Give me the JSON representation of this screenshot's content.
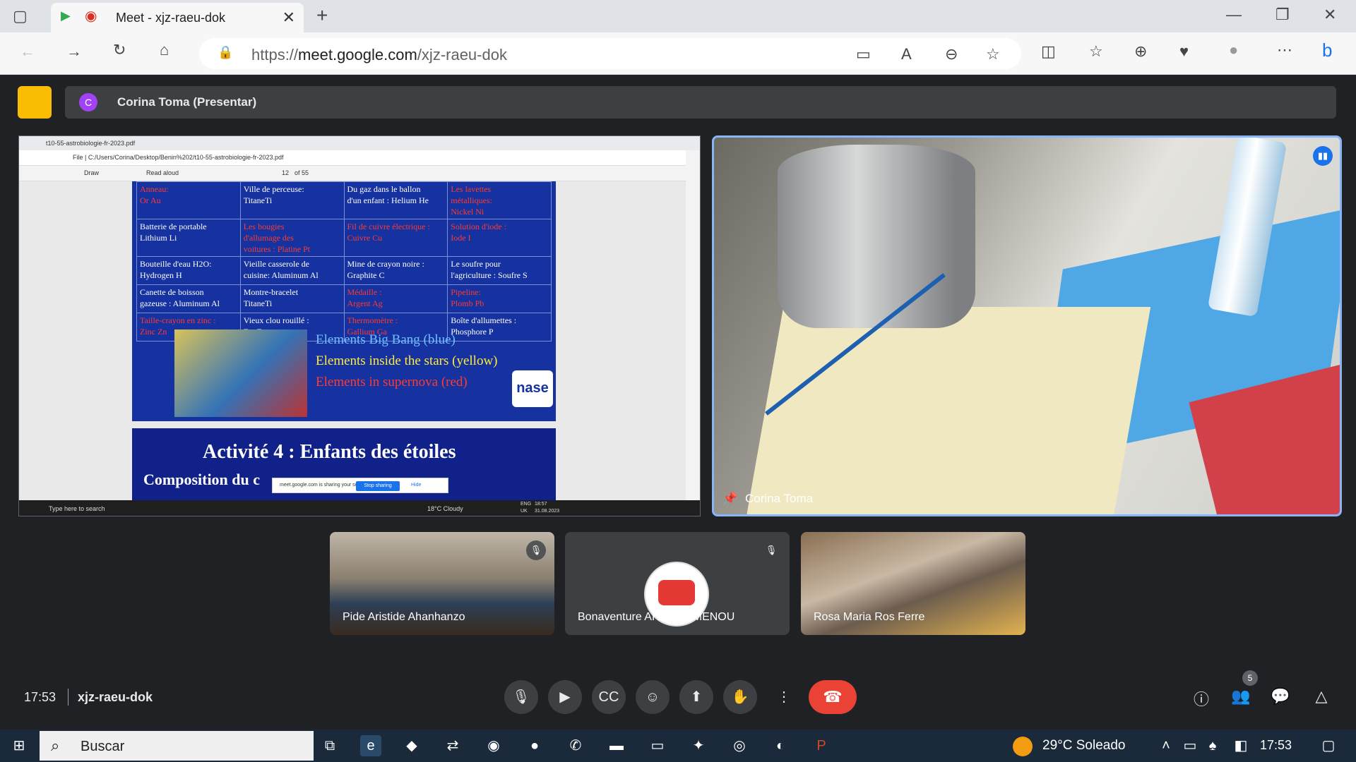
{
  "browser": {
    "tab_title": "Meet - xjz-raeu-dok",
    "url_prefix": "https://",
    "url_host": "meet.google.com",
    "url_path": "/xjz-raeu-dok"
  },
  "meet": {
    "presenter_initial": "C",
    "presenter_banner": "Corina Toma (Presentar)",
    "main_video_name": "Corina Toma",
    "participants": [
      {
        "name": "Pide Aristide Ahanhanzo",
        "muted": true
      },
      {
        "name": "Bonaventure AHOUANMENOU",
        "muted": true
      },
      {
        "name": "Rosa Maria Ros Ferre",
        "muted": false
      }
    ],
    "time": "17:53",
    "meeting_code": "xjz-raeu-dok",
    "participant_count": "5"
  },
  "shared_screen": {
    "pdf_tab": "t10-55-astrobiologie-fr-2023.pdf",
    "pdf_path": "File | C:/Users/Corina/Desktop/Benin%202/t10-55-astrobiologie-fr-2023.pdf",
    "draw_label": "Draw",
    "read_aloud": "Read aloud",
    "page_num": "12",
    "page_total": "of 55",
    "table_rows": [
      [
        {
          "t": "Anneau:\nOr Au",
          "c": "r"
        },
        {
          "t": "Ville de perceuse:\nTitaneTi",
          "c": "w"
        },
        {
          "t": "Du gaz dans le ballon\nd'un enfant : Helium He",
          "c": "w"
        },
        {
          "t": "Les lavettes\nmétalliques:\nNickel Ni",
          "c": "r"
        }
      ],
      [
        {
          "t": "Batterie de portable\nLithium Li",
          "c": "w"
        },
        {
          "t": "Les bougies\nd'allumage des\nvoitures : Platine Pt",
          "c": "r"
        },
        {
          "t": "Fil de cuivre électrique :\nCuivre Cu",
          "c": "r"
        },
        {
          "t": "Solution d'iode :\nIode I",
          "c": "r"
        }
      ],
      [
        {
          "t": "Bouteille d'eau H2O:\nHydrogen H",
          "c": "w"
        },
        {
          "t": "Vieille casserole de\ncuisine: Aluminum Al",
          "c": "w"
        },
        {
          "t": "Mine de crayon noire :\nGraphite C",
          "c": "w"
        },
        {
          "t": "Le soufre pour\nl'agriculture : Soufre S",
          "c": "w"
        }
      ],
      [
        {
          "t": "Canette de boisson\ngazeuse : Aluminum Al",
          "c": "w"
        },
        {
          "t": "Montre-bracelet\nTitaneTi",
          "c": "w"
        },
        {
          "t": "Médaille :\nArgent Ag",
          "c": "r"
        },
        {
          "t": "Pipeline:\nPlomb Pb",
          "c": "r"
        }
      ],
      [
        {
          "t": "Taille-crayon en zinc :\nZinc Zn",
          "c": "r"
        },
        {
          "t": "Vieux clou rouillé :\nFer Fe",
          "c": "w"
        },
        {
          "t": "Thermomètre :\nGallium Ga",
          "c": "r"
        },
        {
          "t": "Boîte d'allumettes :\nPhosphore P",
          "c": "w"
        }
      ]
    ],
    "legend": [
      {
        "text": "Elements Big Bang (blue)",
        "color": "#6ec0ff"
      },
      {
        "text": "Elements inside the stars (yellow)",
        "color": "#ffeb3b"
      },
      {
        "text": "Elements in supernova (red)",
        "color": "#ff3b2f"
      }
    ],
    "nase_logo": "nase",
    "slide2_title": "Activité 4 : Enfants des étoiles",
    "slide2_sub": "Composition du c",
    "share_notice": "meet.google.com is sharing your screen.",
    "stop_sharing": "Stop sharing",
    "hide": "Hide",
    "inner_search": "Type here to search",
    "inner_weather": "18°C Cloudy",
    "inner_lang": "ENG\nUK",
    "inner_clock": "18:57\n31.08.2023"
  },
  "taskbar": {
    "search_placeholder": "Buscar",
    "weather": "29°C Soleado",
    "clock": "17:53"
  }
}
